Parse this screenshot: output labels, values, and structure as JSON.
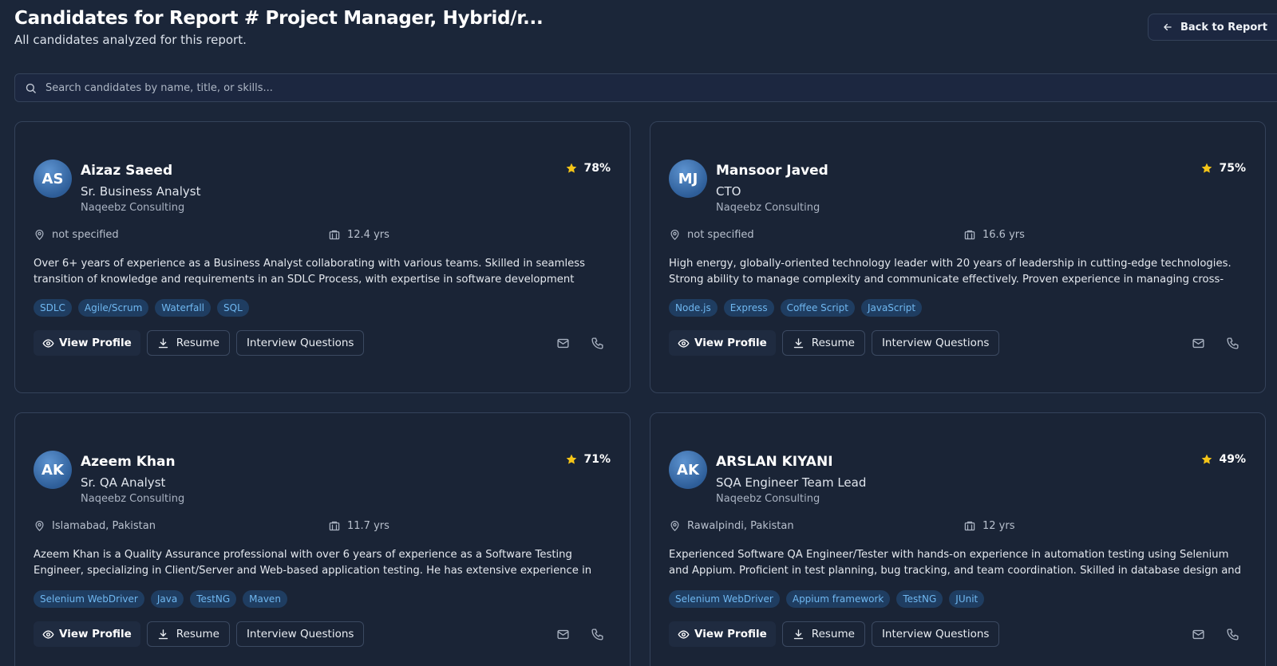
{
  "header": {
    "title": "Candidates for Report # Project Manager, Hybrid/r...",
    "subtitle": "All candidates analyzed for this report.",
    "back_label": "Back to Report"
  },
  "search": {
    "placeholder": "Search candidates by name, title, or skills..."
  },
  "actions": {
    "view_profile": "View Profile",
    "resume": "Resume",
    "interview_questions": "Interview Questions"
  },
  "colors": {
    "background": "#1b2639",
    "card": "#1a2436",
    "star": "#f5c518",
    "tag_bg": "#1f3d61",
    "tag_text": "#6fb7f0"
  },
  "candidates": [
    {
      "initials": "AS",
      "name": "Aizaz Saeed",
      "title": "Sr. Business Analyst",
      "company": "Naqeebz Consulting",
      "score": "78%",
      "location": "not specified",
      "experience": "12.4 yrs",
      "summary": "Over 6+ years of experience as a Business Analyst collaborating with various teams. Skilled in seamless transition of knowledge and requirements in an SDLC Process, with expertise in software development methodologies such as...",
      "tags": [
        "SDLC",
        "Agile/Scrum",
        "Waterfall",
        "SQL"
      ]
    },
    {
      "initials": "MJ",
      "name": "Mansoor Javed",
      "title": "CTO",
      "company": "Naqeebz Consulting",
      "score": "75%",
      "location": "not specified",
      "experience": "16.6 yrs",
      "summary": "High energy, globally-oriented technology leader with 20 years of leadership in cutting-edge technologies. Strong ability to manage complexity and communicate effectively. Proven experience in managing cross-functional teams and...",
      "tags": [
        "Node.js",
        "Express",
        "Coffee Script",
        "JavaScript"
      ]
    },
    {
      "initials": "AK",
      "name": "Azeem Khan",
      "title": "Sr. QA Analyst",
      "company": "Naqeebz Consulting",
      "score": "71%",
      "location": "Islamabad, Pakistan",
      "experience": "11.7 yrs",
      "summary": "Azeem Khan is a Quality Assurance professional with over 6 years of experience as a Software Testing Engineer, specializing in Client/Server and Web-based application testing. He has extensive experience in automation using...",
      "tags": [
        "Selenium WebDriver",
        "Java",
        "TestNG",
        "Maven"
      ]
    },
    {
      "initials": "AK",
      "name": "ARSLAN KIYANI",
      "title": "SQA Engineer Team Lead",
      "company": "Naqeebz Consulting",
      "score": "49%",
      "location": "Rawalpindi, Pakistan",
      "experience": "12 yrs",
      "summary": "Experienced Software QA Engineer/Tester with hands-on experience in automation testing using Selenium and Appium. Proficient in test planning, bug tracking, and team coordination. Skilled in database design and development, along...",
      "tags": [
        "Selenium WebDriver",
        "Appium framework",
        "TestNG",
        "JUnit"
      ]
    }
  ]
}
